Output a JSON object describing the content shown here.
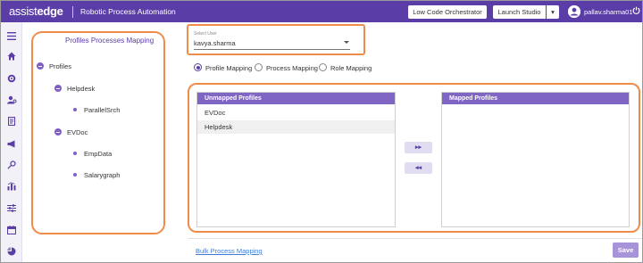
{
  "header": {
    "logo_part1": "assist",
    "logo_part2": "edge",
    "app_title": "Robotic Process Automation",
    "low_code_button": "Low Code Orchestrator",
    "launch_studio_button": "Launch Studio",
    "launch_studio_caret": "▾",
    "username": "pallav.sharma01",
    "power_icon": "power-icon"
  },
  "sidebar": {
    "icons": [
      "menu-icon",
      "home-icon",
      "settings-icon",
      "users-icon",
      "document-icon",
      "megaphone-icon",
      "key-icon",
      "analytics-icon",
      "sliders-icon",
      "calendar-icon",
      "pie-chart-icon"
    ]
  },
  "tree": {
    "title": "Profiles Processes Mapping",
    "root": "Profiles",
    "nodes": [
      {
        "label": "Helpdesk",
        "children": [
          "ParallelSrch"
        ]
      },
      {
        "label": "EVDoc",
        "children": [
          "EmpData",
          "Salarygraph"
        ]
      }
    ]
  },
  "select_user": {
    "label": "Select User",
    "value": "kavya.sharma"
  },
  "radio_options": [
    {
      "label": "Profile Mapping",
      "selected": true
    },
    {
      "label": "Process Mapping",
      "selected": false
    },
    {
      "label": "Role Mapping",
      "selected": false
    }
  ],
  "unmapped": {
    "header": "Unmapped Profiles",
    "items": [
      "EVDoc",
      "Helpdesk"
    ]
  },
  "mapped": {
    "header": "Mapped Profiles",
    "items": []
  },
  "move_buttons": {
    "move_right": "▸▸",
    "move_left": "◂◂"
  },
  "footer": {
    "bulk_link": "Bulk Process Mapping",
    "save_button": "Save"
  },
  "colors": {
    "brand": "#5b3da8",
    "list_header": "#7f65c4",
    "highlight_outline": "#f08c4b",
    "save_button": "#a793da"
  }
}
